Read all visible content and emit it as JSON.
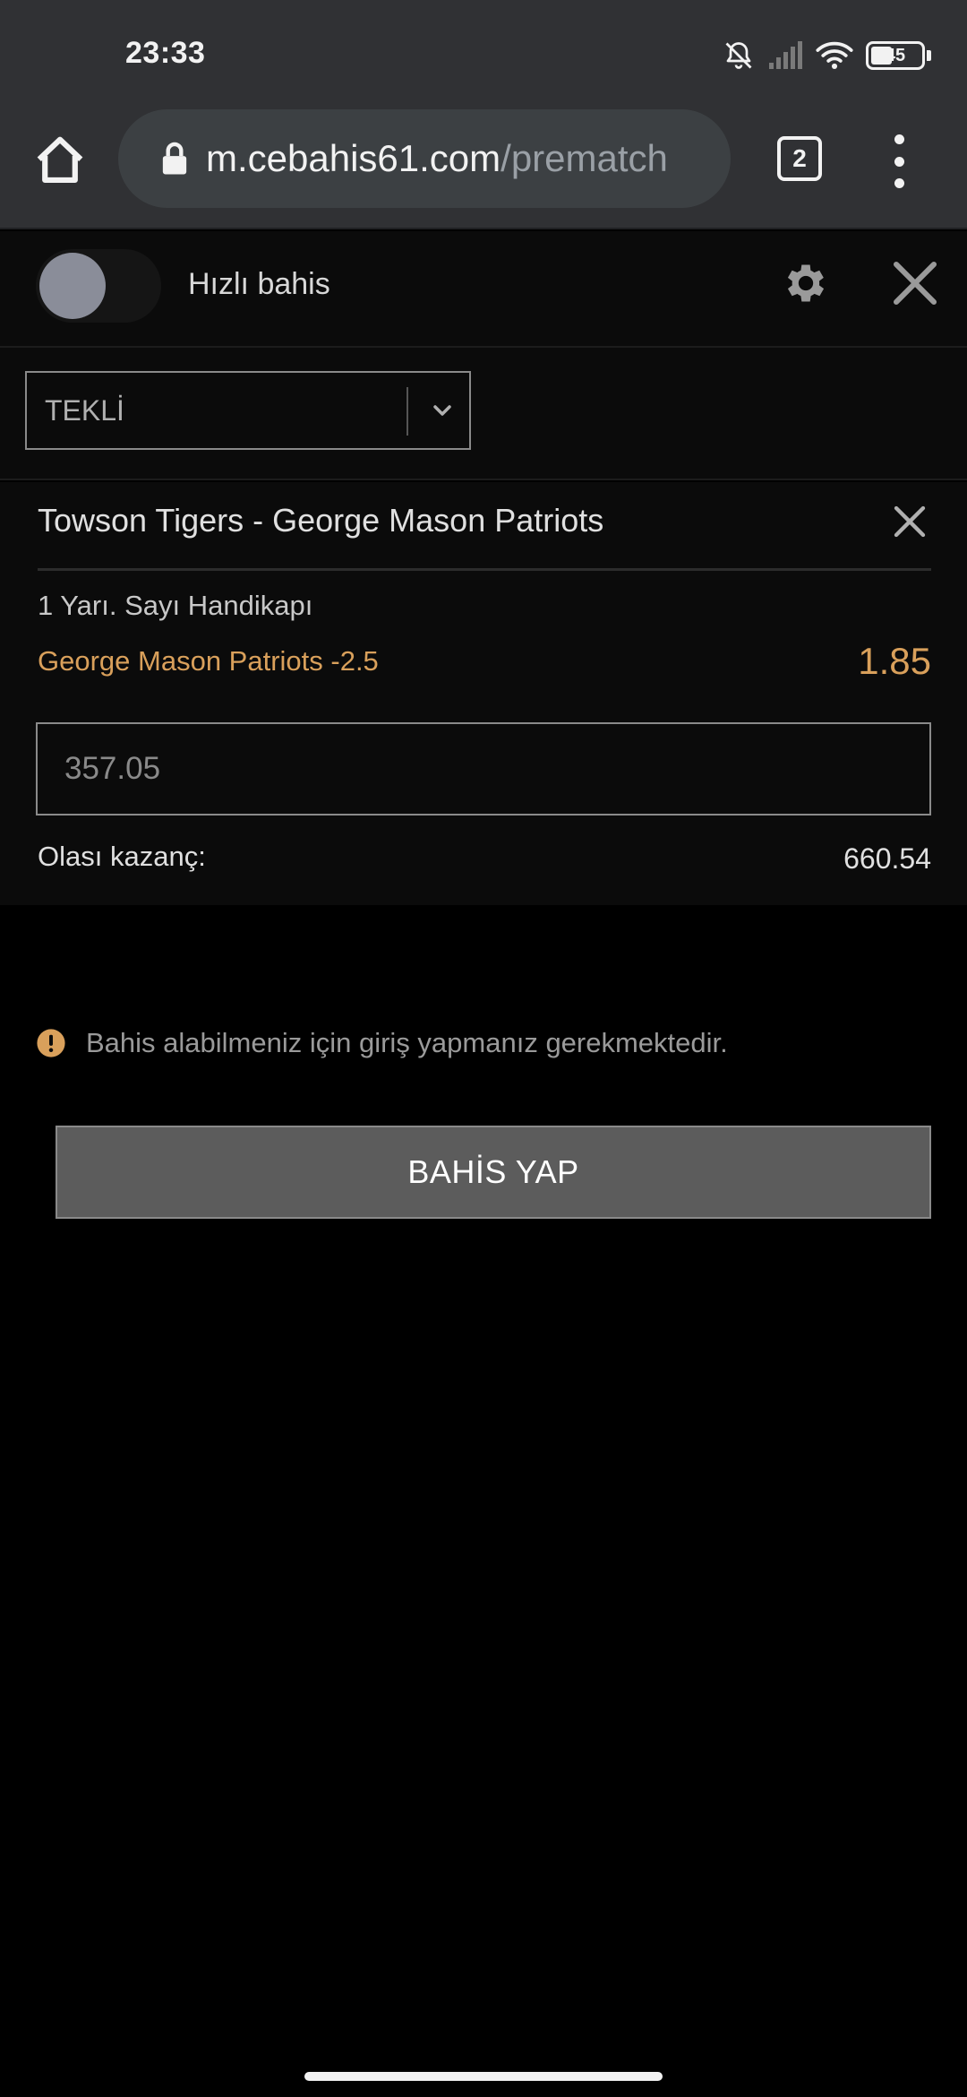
{
  "status_bar": {
    "time": "23:33",
    "battery_level": "45",
    "icons": [
      "bell-off-icon",
      "signal-icon",
      "wifi-icon",
      "battery-icon"
    ]
  },
  "browser": {
    "url_host": "m.cebahis61.com",
    "url_path": "/prematch",
    "tab_count": "2",
    "icons": [
      "home-icon",
      "lock-icon",
      "tabs-icon",
      "more-vert-icon"
    ]
  },
  "betslip": {
    "quick_bet_label": "Hızlı bahis",
    "quick_bet_enabled": false,
    "bet_type": "TEKLİ",
    "icons": [
      "gear-icon",
      "close-icon",
      "chevron-down-icon"
    ]
  },
  "bet": {
    "match": "Towson Tigers - George Mason Patriots",
    "market": "1 Yarı. Sayı Handikapı",
    "selection": "George Mason Patriots -2.5",
    "odds": "1.85",
    "stake_placeholder": "357.05",
    "possible_win_label": "Olası kazanç:",
    "possible_win_value": "660.54"
  },
  "warning": {
    "text": "Bahis alabilmeniz için giriş yapmanız gerekmektedir.",
    "icon": "exclamation-circle-icon"
  },
  "actions": {
    "place_bet_label": "BAHİS YAP"
  },
  "colors": {
    "accent": "#d9a05b",
    "chrome": "#303134",
    "background": "#000000",
    "panel": "#0b0b0b",
    "button": "#5c5c5c",
    "warning": "#d9a05b"
  }
}
